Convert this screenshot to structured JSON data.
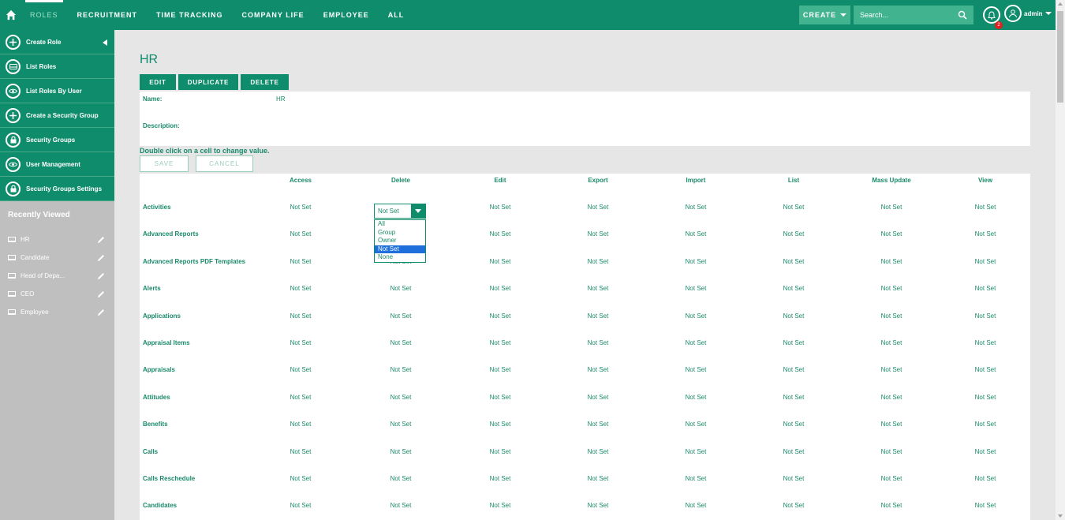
{
  "nav": {
    "items": [
      "ROLES",
      "RECRUITMENT",
      "TIME TRACKING",
      "COMPANY LIFE",
      "EMPLOYEE",
      "ALL"
    ],
    "create_label": "CREATE",
    "search_placeholder": "Search...",
    "notification_count": "2",
    "user_label": "admin"
  },
  "sidebar": {
    "actions": [
      {
        "label": "Create Role",
        "icon": "plus-icon"
      },
      {
        "label": "List Roles",
        "icon": "list-icon"
      },
      {
        "label": "List Roles By User",
        "icon": "eye-icon"
      },
      {
        "label": "Create a Security Group",
        "icon": "plus-icon"
      },
      {
        "label": "Security Groups",
        "icon": "lock-icon"
      },
      {
        "label": "User Management",
        "icon": "eye-icon"
      },
      {
        "label": "Security Groups Settings",
        "icon": "lock-icon"
      }
    ],
    "recent_title": "Recently Viewed",
    "recent": [
      "HR",
      "Candidate",
      "Head of Depa...",
      "CEO",
      "Employee"
    ]
  },
  "main": {
    "title": "HR",
    "buttons": [
      "EDIT",
      "DUPLICATE",
      "DELETE"
    ],
    "name_label": "Name:",
    "name_value": "HR",
    "description_label": "Description:",
    "hint": "Double click on a cell to change value.",
    "save_label": "SAVE",
    "cancel_label": "CANCEL"
  },
  "grid": {
    "columns": [
      "Access",
      "Delete",
      "Edit",
      "Export",
      "Import",
      "List",
      "Mass Update",
      "View"
    ],
    "rows": [
      "Activities",
      "Advanced Reports",
      "Advanced Reports PDF Templates",
      "Alerts",
      "Applications",
      "Appraisal Items",
      "Appraisals",
      "Attitudes",
      "Benefits",
      "Calls",
      "Calls Reschedule",
      "Candidates"
    ],
    "cell_value": "Not Set"
  },
  "dropdown": {
    "value": "Not Set",
    "options": [
      "All",
      "Group",
      "Owner",
      "Not Set",
      "None"
    ],
    "selected": "Not Set"
  },
  "colors": {
    "brand": "#0f8c6c",
    "text": "#1a8a6a",
    "sidebar_bg": "#bfbfbf",
    "selection": "#1e6fdc",
    "badge": "#e02020"
  }
}
